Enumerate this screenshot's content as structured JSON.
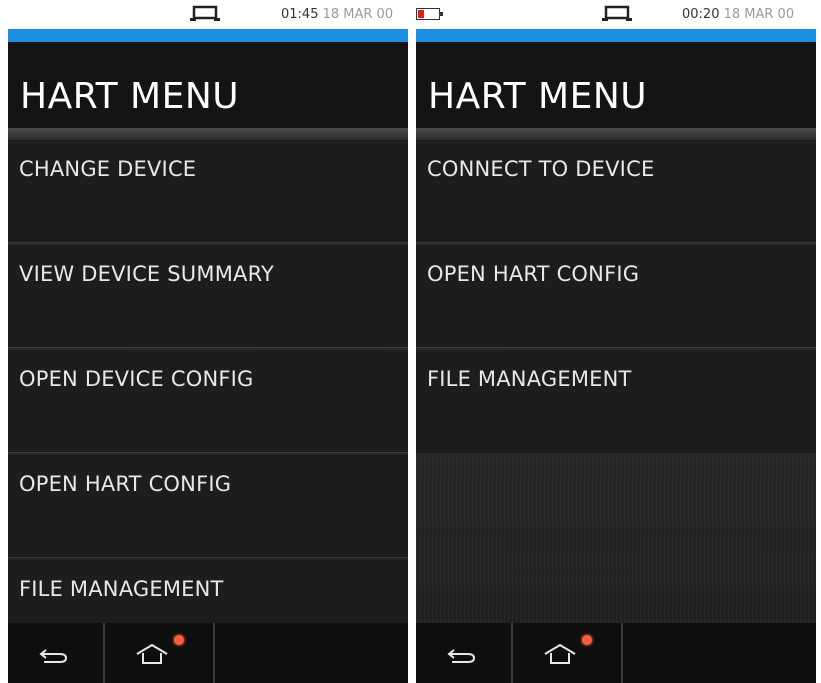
{
  "screens": [
    {
      "status": {
        "time": "01:45",
        "date": "18 MAR 00",
        "show_battery": false
      },
      "title": "HART MENU",
      "menu": [
        {
          "label": "CHANGE DEVICE"
        },
        {
          "label": "VIEW DEVICE SUMMARY"
        },
        {
          "label": "OPEN DEVICE CONFIG"
        },
        {
          "label": "OPEN HART CONFIG"
        },
        {
          "label": "FILE MANAGEMENT"
        }
      ]
    },
    {
      "status": {
        "time": "00:20",
        "date": "18 MAR 00",
        "show_battery": true
      },
      "title": "HART MENU",
      "menu": [
        {
          "label": "CONNECT TO DEVICE"
        },
        {
          "label": "OPEN HART CONFIG"
        },
        {
          "label": "FILE MANAGEMENT"
        }
      ]
    }
  ],
  "icons": {
    "status": "usb-connection-icon",
    "battery": "battery-low-icon",
    "back": "back-arrow-icon",
    "home": "home-icon",
    "notification": "notification-dot"
  },
  "colors": {
    "accent": "#1f8fe3",
    "battery_low": "#e0201a",
    "notification": "#ff5a3c",
    "menu_bg": "#1d1d1d",
    "title_bg": "#141414"
  }
}
